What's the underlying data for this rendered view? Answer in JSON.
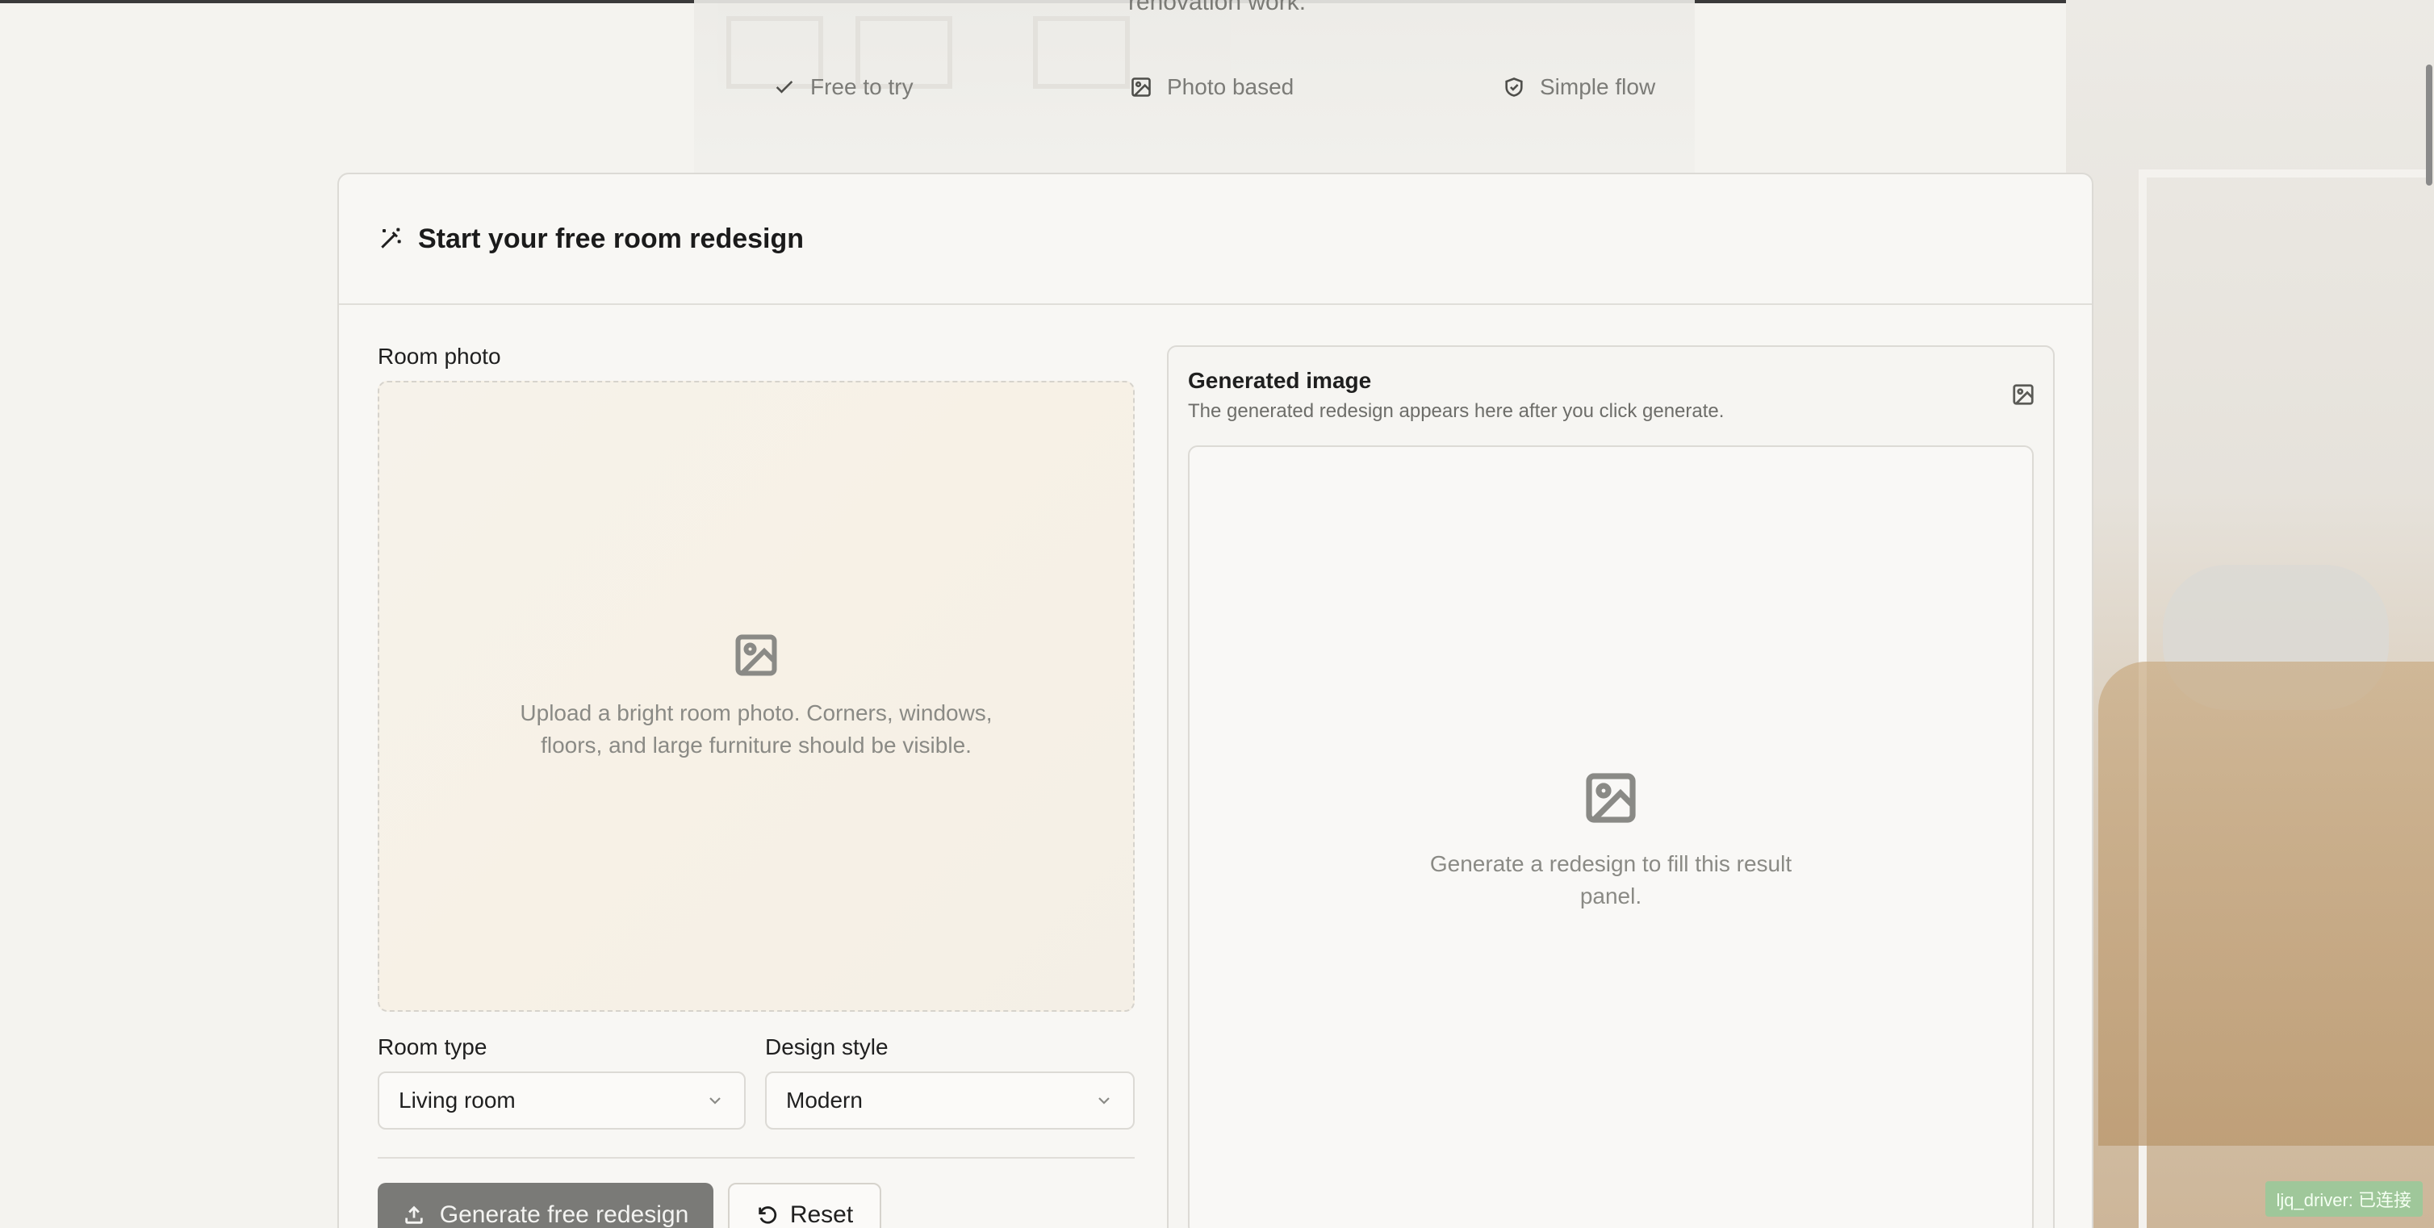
{
  "header": {
    "subtitle_partial": "renovation work."
  },
  "features": [
    {
      "label": "Free to try",
      "icon": "check-icon"
    },
    {
      "label": "Photo based",
      "icon": "image-icon"
    },
    {
      "label": "Simple flow",
      "icon": "shield-check-icon"
    }
  ],
  "card": {
    "title": "Start your free room redesign",
    "title_icon": "magic-wand-icon"
  },
  "upload": {
    "label": "Room photo",
    "hint": "Upload a bright room photo. Corners, windows, floors, and large furniture should be visible."
  },
  "room_type": {
    "label": "Room type",
    "value": "Living room"
  },
  "design_style": {
    "label": "Design style",
    "value": "Modern"
  },
  "actions": {
    "generate_label": "Generate free redesign",
    "reset_label": "Reset"
  },
  "result": {
    "title": "Generated image",
    "subtitle": "The generated redesign appears here after you click generate.",
    "empty_text": "Generate a redesign to fill this result panel."
  },
  "status_badge": {
    "text": "ljq_driver: 已连接"
  },
  "colors": {
    "background": "#f4f3ef",
    "card": "#f8f7f4",
    "primary_button": "#7a7a77",
    "badge": "#9fc79a"
  }
}
